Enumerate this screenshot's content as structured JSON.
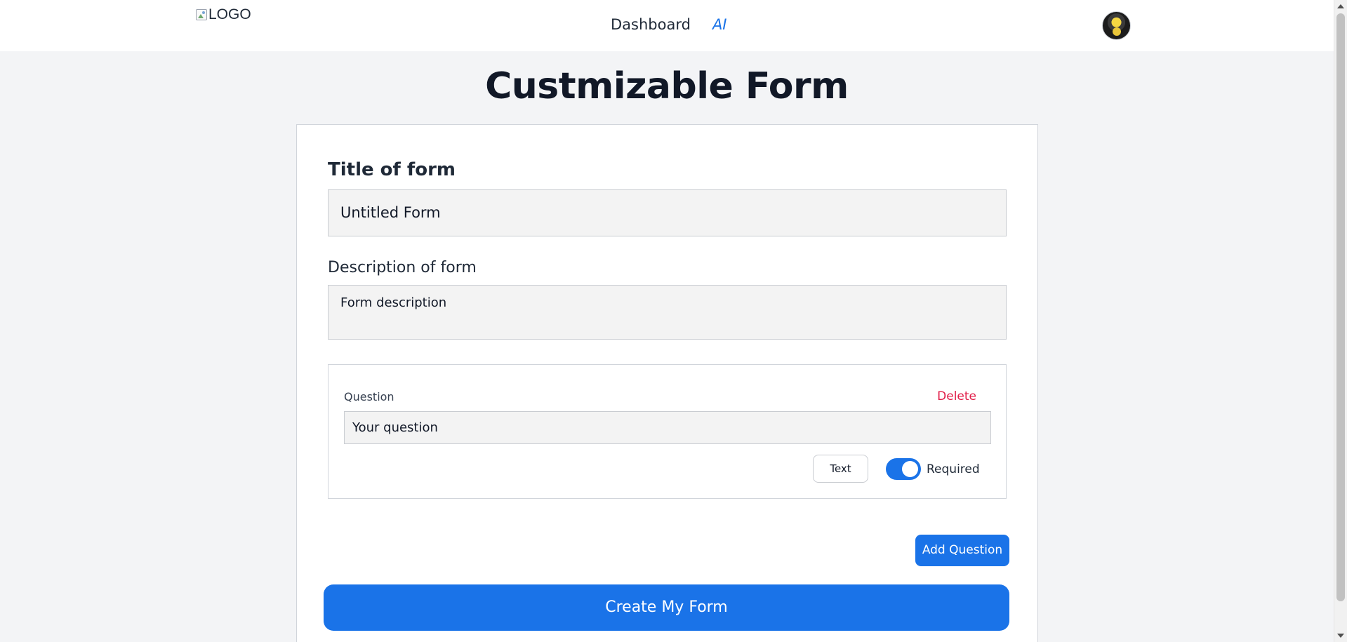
{
  "nav": {
    "logo_alt": "LOGO",
    "links": [
      {
        "label": "Dashboard"
      },
      {
        "label": "AI"
      }
    ]
  },
  "page": {
    "title": "Custmizable Form"
  },
  "form": {
    "title_label": "Title of form",
    "title_value": "Untitled Form",
    "description_label": "Description of form",
    "description_value": "Form description",
    "question": {
      "label": "Question",
      "delete_label": "Delete",
      "input_value": "Your question",
      "type_label": "Text",
      "required_label": "Required",
      "required_on": true
    },
    "add_question_label": "Add Question",
    "create_label": "Create My Form"
  },
  "colors": {
    "accent": "#1a73e8",
    "delete": "#e11d48",
    "background": "#f3f4f6"
  }
}
